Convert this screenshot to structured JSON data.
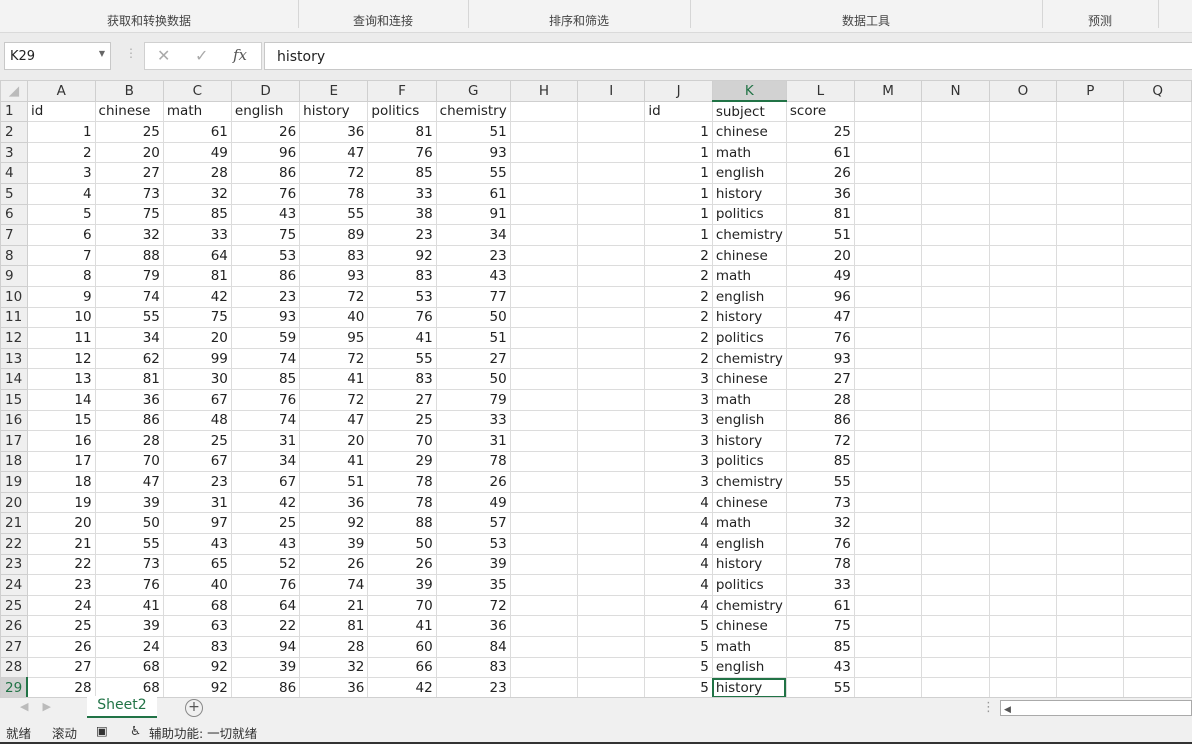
{
  "ribbon": {
    "groups": [
      "获取和转换数据",
      "查询和连接",
      "排序和筛选",
      "数据工具",
      "预测"
    ]
  },
  "formula_bar": {
    "name_box": "K29",
    "cancel_icon": "✕",
    "enter_icon": "✓",
    "fx_label": "fx",
    "value": "history"
  },
  "columns": [
    "A",
    "B",
    "C",
    "D",
    "E",
    "F",
    "G",
    "H",
    "I",
    "J",
    "K",
    "L",
    "M",
    "N",
    "O",
    "P",
    "Q"
  ],
  "wide_table": {
    "headers": [
      "id",
      "chinese",
      "math",
      "english",
      "history",
      "politics",
      "chemistry"
    ],
    "rows": [
      [
        1,
        25,
        61,
        26,
        36,
        81,
        51
      ],
      [
        2,
        20,
        49,
        96,
        47,
        76,
        93
      ],
      [
        3,
        27,
        28,
        86,
        72,
        85,
        55
      ],
      [
        4,
        73,
        32,
        76,
        78,
        33,
        61
      ],
      [
        5,
        75,
        85,
        43,
        55,
        38,
        91
      ],
      [
        6,
        32,
        33,
        75,
        89,
        23,
        34
      ],
      [
        7,
        88,
        64,
        53,
        83,
        92,
        23
      ],
      [
        8,
        79,
        81,
        86,
        93,
        83,
        43
      ],
      [
        9,
        74,
        42,
        23,
        72,
        53,
        77
      ],
      [
        10,
        55,
        75,
        93,
        40,
        76,
        50
      ],
      [
        11,
        34,
        20,
        59,
        95,
        41,
        51
      ],
      [
        12,
        62,
        99,
        74,
        72,
        55,
        27
      ],
      [
        13,
        81,
        30,
        85,
        41,
        83,
        50
      ],
      [
        14,
        36,
        67,
        76,
        72,
        27,
        79
      ],
      [
        15,
        86,
        48,
        74,
        47,
        25,
        33
      ],
      [
        16,
        28,
        25,
        31,
        20,
        70,
        31
      ],
      [
        17,
        70,
        67,
        34,
        41,
        29,
        78
      ],
      [
        18,
        47,
        23,
        67,
        51,
        78,
        26
      ],
      [
        19,
        39,
        31,
        42,
        36,
        78,
        49
      ],
      [
        20,
        50,
        97,
        25,
        92,
        88,
        57
      ],
      [
        21,
        55,
        43,
        43,
        39,
        50,
        53
      ],
      [
        22,
        73,
        65,
        52,
        26,
        26,
        39
      ],
      [
        23,
        76,
        40,
        76,
        74,
        39,
        35
      ],
      [
        24,
        41,
        68,
        64,
        21,
        70,
        72
      ],
      [
        25,
        39,
        63,
        22,
        81,
        41,
        36
      ],
      [
        26,
        24,
        83,
        94,
        28,
        60,
        84
      ],
      [
        27,
        68,
        92,
        39,
        32,
        66,
        83
      ],
      [
        28,
        68,
        92,
        86,
        36,
        42,
        23
      ]
    ]
  },
  "long_table": {
    "headers": [
      "id",
      "subject",
      "score"
    ],
    "rows": [
      [
        1,
        "chinese",
        25
      ],
      [
        1,
        "math",
        61
      ],
      [
        1,
        "english",
        26
      ],
      [
        1,
        "history",
        36
      ],
      [
        1,
        "politics",
        81
      ],
      [
        1,
        "chemistry",
        51
      ],
      [
        2,
        "chinese",
        20
      ],
      [
        2,
        "math",
        49
      ],
      [
        2,
        "english",
        96
      ],
      [
        2,
        "history",
        47
      ],
      [
        2,
        "politics",
        76
      ],
      [
        2,
        "chemistry",
        93
      ],
      [
        3,
        "chinese",
        27
      ],
      [
        3,
        "math",
        28
      ],
      [
        3,
        "english",
        86
      ],
      [
        3,
        "history",
        72
      ],
      [
        3,
        "politics",
        85
      ],
      [
        3,
        "chemistry",
        55
      ],
      [
        4,
        "chinese",
        73
      ],
      [
        4,
        "math",
        32
      ],
      [
        4,
        "english",
        76
      ],
      [
        4,
        "history",
        78
      ],
      [
        4,
        "politics",
        33
      ],
      [
        4,
        "chemistry",
        61
      ],
      [
        5,
        "chinese",
        75
      ],
      [
        5,
        "math",
        85
      ],
      [
        5,
        "english",
        43
      ],
      [
        5,
        "history",
        55
      ]
    ]
  },
  "sheet_tab": "Sheet2",
  "add_sheet": "+",
  "status": {
    "ready": "就绪",
    "scroll": "滚动",
    "accessibility": "辅助功能: 一切就绪"
  },
  "accent": "#217346"
}
